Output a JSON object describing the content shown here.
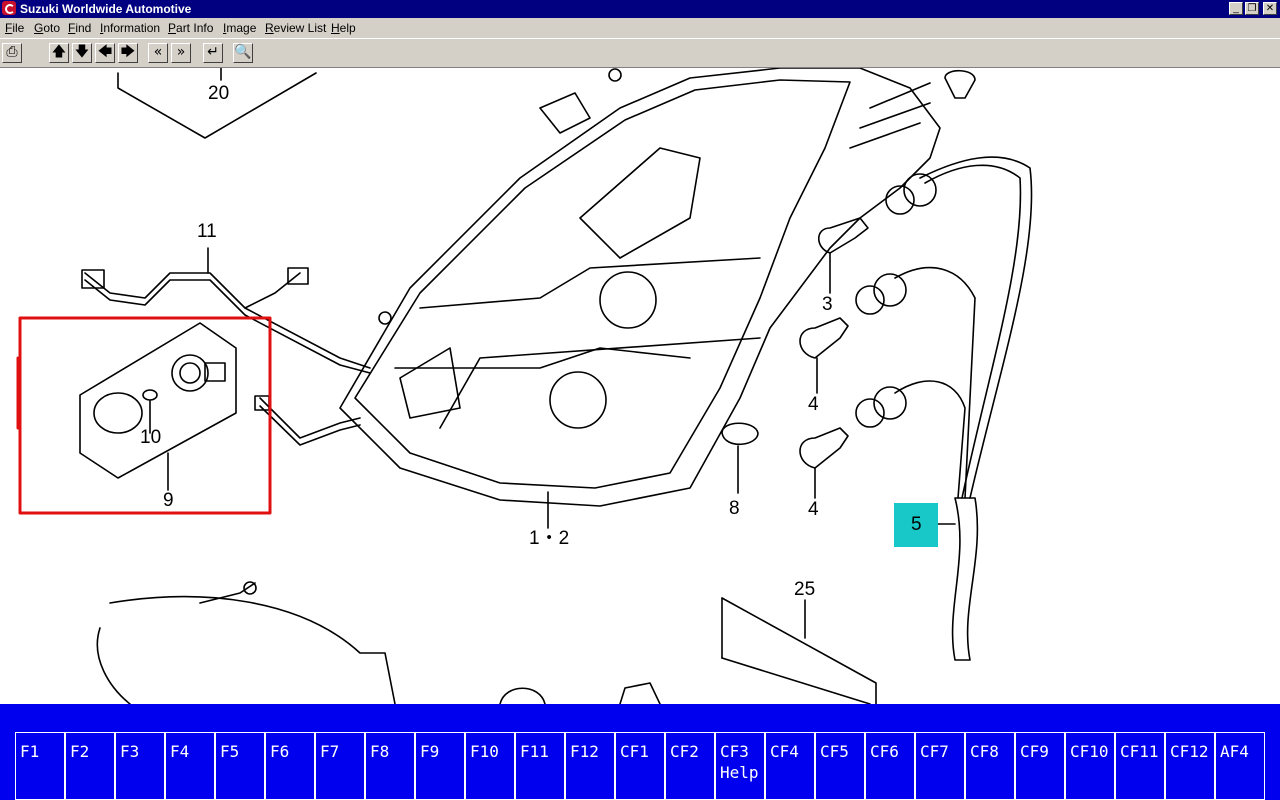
{
  "window": {
    "title": "Suzuki Worldwide Automotive",
    "min": "_",
    "max": "❐",
    "close": "✕"
  },
  "menu": [
    "File",
    "Goto",
    "Find",
    "Information",
    "Part Info",
    "Image",
    "Review List",
    "Help"
  ],
  "toolbar": {
    "print": "⎙",
    "up": "🡅",
    "down": "🡇",
    "left": "🡄",
    "right": "🡆",
    "prev": "«",
    "next": "»",
    "enter": "↵",
    "search": "🔍"
  },
  "diagram": {
    "callouts": [
      "20",
      "11",
      "10",
      "9",
      "3",
      "4",
      "4",
      "8",
      "1・2",
      "5",
      "25"
    ],
    "highlighted_callout": "5",
    "highlight_color": "#18c8c8",
    "selection_color": "#e01010"
  },
  "fkeys": [
    {
      "label": "F1",
      "sub": ""
    },
    {
      "label": "F2",
      "sub": ""
    },
    {
      "label": "F3",
      "sub": ""
    },
    {
      "label": "F4",
      "sub": ""
    },
    {
      "label": "F5",
      "sub": ""
    },
    {
      "label": "F6",
      "sub": ""
    },
    {
      "label": "F7",
      "sub": ""
    },
    {
      "label": "F8",
      "sub": ""
    },
    {
      "label": "F9",
      "sub": ""
    },
    {
      "label": "F10",
      "sub": ""
    },
    {
      "label": "F11",
      "sub": ""
    },
    {
      "label": "F12",
      "sub": ""
    },
    {
      "label": "CF1",
      "sub": ""
    },
    {
      "label": "CF2",
      "sub": ""
    },
    {
      "label": "CF3",
      "sub": "Help"
    },
    {
      "label": "CF4",
      "sub": ""
    },
    {
      "label": "CF5",
      "sub": ""
    },
    {
      "label": "CF6",
      "sub": ""
    },
    {
      "label": "CF7",
      "sub": ""
    },
    {
      "label": "CF8",
      "sub": ""
    },
    {
      "label": "CF9",
      "sub": ""
    },
    {
      "label": "CF10",
      "sub": ""
    },
    {
      "label": "CF11",
      "sub": ""
    },
    {
      "label": "CF12",
      "sub": ""
    },
    {
      "label": "AF4",
      "sub": ""
    }
  ]
}
